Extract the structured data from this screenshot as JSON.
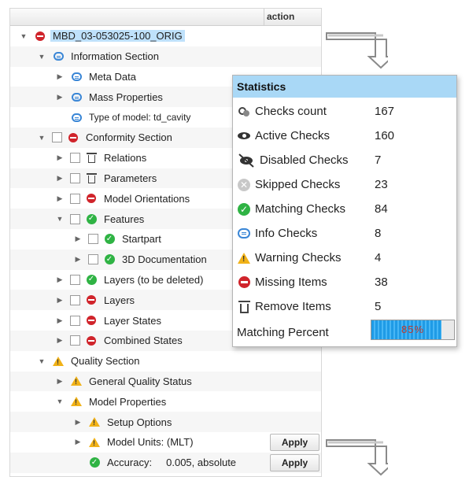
{
  "tree": {
    "action_header": "action",
    "rows": [
      {
        "label": "MBD_03-053025-100_ORIG",
        "icon": "stop-icon"
      },
      {
        "label": "Information Section",
        "icon": "info-bubble-icon"
      },
      {
        "label": "Meta Data",
        "icon": "info-bubble-icon"
      },
      {
        "label": "Mass Properties",
        "icon": "info-bubble-icon"
      },
      {
        "label": "Type of model:  td_cavity",
        "icon": "info-bubble-icon"
      },
      {
        "label": "Conformity Section",
        "icon": "stop-icon"
      },
      {
        "label": "Relations",
        "icon": "trash-icon"
      },
      {
        "label": "Parameters",
        "icon": "trash-icon"
      },
      {
        "label": "Model Orientations",
        "icon": "stop-icon"
      },
      {
        "label": "Features",
        "icon": "check-icon"
      },
      {
        "label": "Startpart",
        "icon": "check-icon"
      },
      {
        "label": "3D Documentation",
        "icon": "check-icon"
      },
      {
        "label": "Layers (to be deleted)",
        "icon": "check-icon"
      },
      {
        "label": "Layers",
        "icon": "stop-icon"
      },
      {
        "label": "Layer States",
        "icon": "stop-icon"
      },
      {
        "label": "Combined States",
        "icon": "stop-icon"
      },
      {
        "label": "Quality Section",
        "icon": "warning-icon"
      },
      {
        "label": "General Quality Status",
        "icon": "warning-icon"
      },
      {
        "label": "Model Properties",
        "icon": "warning-icon"
      },
      {
        "label": "Setup Options",
        "icon": "warning-icon"
      },
      {
        "label": "Model Units:  (MLT)",
        "icon": "warning-icon"
      },
      {
        "label": "Accuracy:     0.005, absolute",
        "icon": "check-icon"
      }
    ],
    "apply_label": "Apply"
  },
  "statistics": {
    "title": "Statistics",
    "rows": [
      {
        "label": "Checks count",
        "value": "167",
        "icon": "checks-count-icon"
      },
      {
        "label": "Active Checks",
        "value": "160",
        "icon": "eye-icon"
      },
      {
        "label": "Disabled Checks",
        "value": "7",
        "icon": "eye-slash-icon"
      },
      {
        "label": "Skipped Checks",
        "value": "23",
        "icon": "skip-icon"
      },
      {
        "label": "Matching Checks",
        "value": "84",
        "icon": "check-icon"
      },
      {
        "label": "Info Checks",
        "value": "8",
        "icon": "info-bubble-icon"
      },
      {
        "label": "Warning Checks",
        "value": "4",
        "icon": "warning-icon"
      },
      {
        "label": "Missing Items",
        "value": "38",
        "icon": "stop-icon"
      },
      {
        "label": "Remove Items",
        "value": "5",
        "icon": "trash-icon"
      }
    ],
    "matching_percent_label": "Matching Percent",
    "matching_percent_text": "85%",
    "matching_percent_value": 85
  },
  "colors": {
    "selection": "#bfe1fb",
    "header": "#a9d8f6",
    "error": "#d0242b",
    "ok": "#2fb344",
    "warning": "#f1b218",
    "info": "#3a86d6",
    "progress": "#1f9be6"
  }
}
